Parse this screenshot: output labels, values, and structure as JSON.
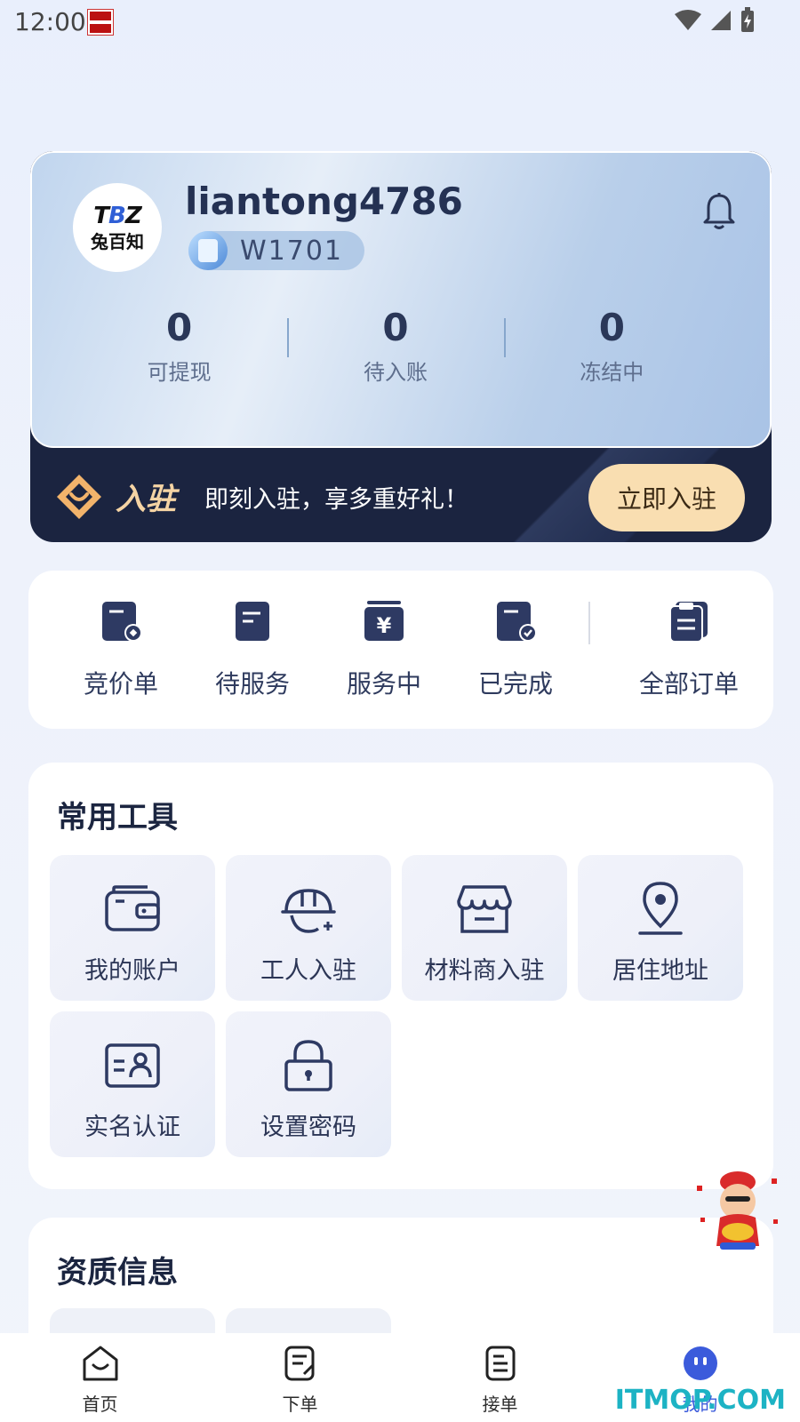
{
  "status_bar": {
    "time": "12:00"
  },
  "profile": {
    "avatar_line1_a": "T",
    "avatar_line1_b": "B",
    "avatar_line1_c": "Z",
    "avatar_line2": "兔百知",
    "username": "liantong4786",
    "level": "W1701",
    "stats": [
      {
        "value": "0",
        "label": "可提现"
      },
      {
        "value": "0",
        "label": "待入账"
      },
      {
        "value": "0",
        "label": "冻结中"
      }
    ]
  },
  "join_banner": {
    "title": "入驻",
    "text": "即刻入驻，享多重好礼！",
    "button": "立即入驻"
  },
  "orders": {
    "items": [
      {
        "label": "竞价单",
        "icon": "bid-order-icon"
      },
      {
        "label": "待服务",
        "icon": "pending-service-icon"
      },
      {
        "label": "服务中",
        "icon": "in-service-icon"
      },
      {
        "label": "已完成",
        "icon": "completed-icon"
      }
    ],
    "all_label": "全部订单"
  },
  "tools": {
    "title": "常用工具",
    "items": [
      {
        "label": "我的账户",
        "icon": "wallet-icon"
      },
      {
        "label": "工人入驻",
        "icon": "hardhat-icon"
      },
      {
        "label": "材料商入驻",
        "icon": "store-icon"
      },
      {
        "label": "居住地址",
        "icon": "location-pin-icon"
      },
      {
        "label": "实名认证",
        "icon": "id-card-icon"
      },
      {
        "label": "设置密码",
        "icon": "lock-icon"
      }
    ]
  },
  "qualifications": {
    "title": "资质信息"
  },
  "bottom_nav": {
    "items": [
      {
        "label": "首页"
      },
      {
        "label": "下单"
      },
      {
        "label": "接单"
      },
      {
        "label": "我的"
      }
    ],
    "active_index": 3
  },
  "watermark": "ITMOP.COM",
  "colors": {
    "accent": "#3b5bdb",
    "join_button": "#f9deb1",
    "card_dark": "#1b2440"
  }
}
